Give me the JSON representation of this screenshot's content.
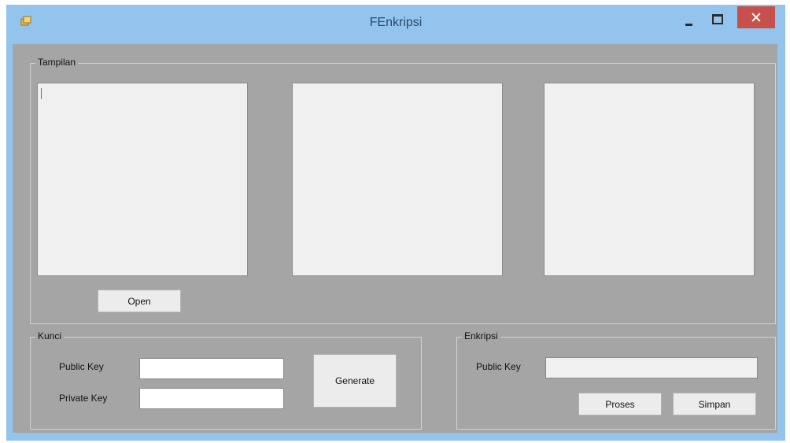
{
  "window": {
    "title": "FEnkripsi",
    "icon": "app-icon",
    "controls": {
      "minimize": "minimize-icon",
      "maximize": "maximize-icon",
      "close": "close-icon",
      "close_color": "#c7504a"
    }
  },
  "colors": {
    "titlebar": "#92c4ee",
    "client": "#a5a5a5",
    "picture": "#f0f0f0"
  },
  "tampilan": {
    "legend": "Tampilan",
    "open_label": "Open"
  },
  "kunci": {
    "legend": "Kunci",
    "public_key_label": "Public Key",
    "public_key_value": "",
    "private_key_label": "Private Key",
    "private_key_value": "",
    "generate_label": "Generate"
  },
  "enkripsi": {
    "legend": "Enkripsi",
    "public_key_label": "Public Key",
    "public_key_value": "",
    "proses_label": "Proses",
    "simpan_label": "Simpan"
  }
}
